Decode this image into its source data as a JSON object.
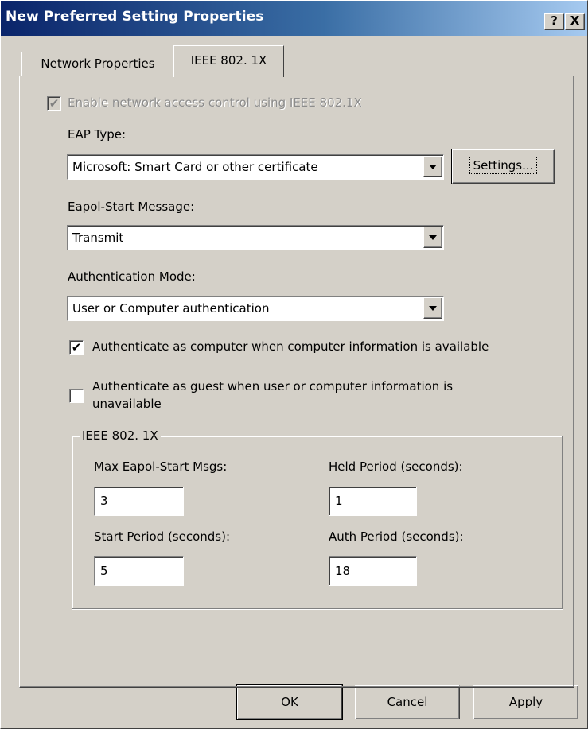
{
  "window": {
    "title": "New Preferred Setting Properties",
    "help_glyph": "?",
    "close_glyph": "X"
  },
  "tabs": [
    {
      "label": "Network Properties",
      "selected": false
    },
    {
      "label": "IEEE 802. 1X",
      "selected": true
    }
  ],
  "enable_nac": {
    "label": "Enable network access control using IEEE 802.1X",
    "checked": true,
    "disabled": true,
    "mark": "✔"
  },
  "eap_type": {
    "label": "EAP Type:",
    "value": "Microsoft: Smart Card or other certificate",
    "settings_label": "Settings..."
  },
  "eapol_start": {
    "label": "Eapol-Start Message:",
    "value": "Transmit"
  },
  "auth_mode": {
    "label": "Authentication Mode:",
    "value": "User or Computer authentication"
  },
  "auth_computer": {
    "label": "Authenticate as computer when computer information is available",
    "checked": true,
    "mark": "✔"
  },
  "auth_guest": {
    "label_line1": "Authenticate as guest when user or computer information is",
    "label_line2": "unavailable",
    "checked": false,
    "mark": ""
  },
  "group": {
    "legend": "IEEE 802. 1X",
    "max_eapol_label": "Max Eapol-Start Msgs:",
    "max_eapol_value": "3",
    "held_period_label": "Held Period (seconds):",
    "held_period_value": "1",
    "start_period_label": "Start Period (seconds):",
    "start_period_value": "5",
    "auth_period_label": "Auth Period (seconds):",
    "auth_period_value": "18"
  },
  "buttons": {
    "ok": "OK",
    "cancel": "Cancel",
    "apply": "Apply"
  }
}
